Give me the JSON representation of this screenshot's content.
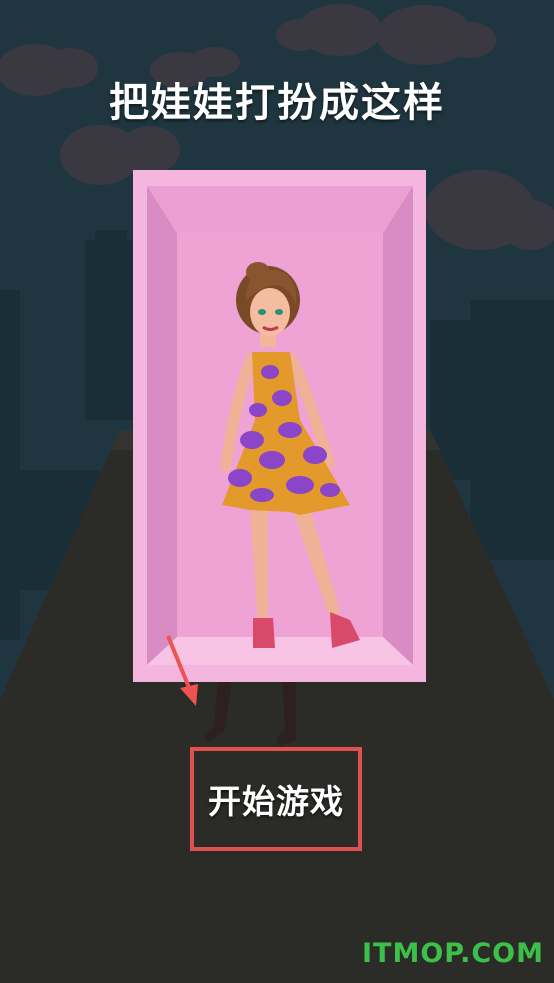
{
  "title": "把娃娃打扮成这样",
  "start_button": {
    "label": "开始游戏"
  },
  "watermark": "ITMOP.COM",
  "colors": {
    "background": "#1f3640",
    "road": "#2b2b28",
    "box_frame": "#f2a7d8",
    "box_inner": "#ef9fd3",
    "dress_main": "#e39a2a",
    "dress_spots": "#8a45c8",
    "highlight_border": "#e05050",
    "watermark": "#3cc04a"
  },
  "icons": {
    "arrow": "red-arrow-down-icon"
  }
}
